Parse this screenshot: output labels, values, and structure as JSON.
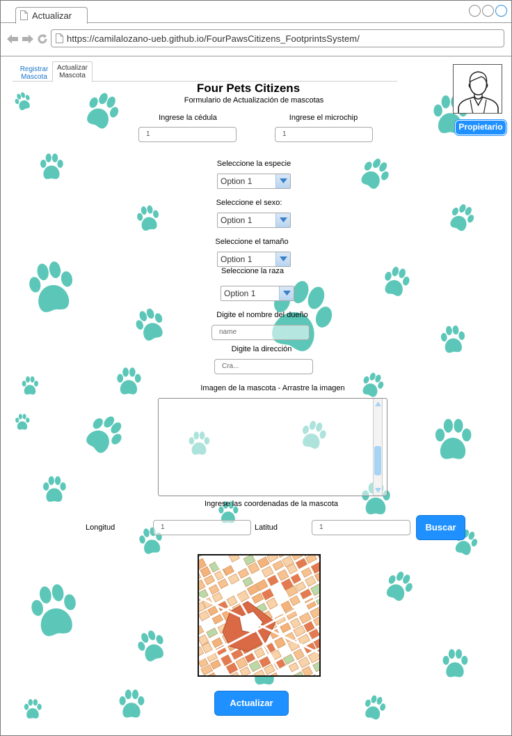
{
  "browser": {
    "tab_title": "Actualizar",
    "url": "https://camilalozano-ueb.github.io/FourPawsCitizens_FootprintsSystem/"
  },
  "tabs": {
    "register_label": "Registrar Mascota",
    "update_label": "Actualizar Mascota"
  },
  "header": {
    "title": "Four Pets Citizens",
    "subtitle": "Formulario de Actualización de mascotas"
  },
  "profile": {
    "owner_button": "Propietario",
    "avatar_icon": "user-avatar-icon"
  },
  "form": {
    "cedula_label": "Ingrese la cédula",
    "cedula_value": "1",
    "microchip_label": "Ingrese el microchip",
    "microchip_value": "1",
    "species_label": "Seleccione la especie",
    "species_value": "Option 1",
    "sex_label": "Seleccione el sexo:",
    "sex_value": "Option 1",
    "size_label": "Seleccione el tamaño",
    "size_value": "Option 1",
    "breed_label": "Seleccione la raza",
    "breed_value": "Option 1",
    "owner_name_label": "Digite el nombre del dueño",
    "owner_name_placeholder": "name",
    "address_label": "Digite la dirección",
    "address_placeholder": "Cra...",
    "image_label": "Imagen de la mascota - Arrastre la imagen",
    "coords_label": "Ingrese las coordenadas de la mascota",
    "longitude_label": "Longitud",
    "longitude_value": "1",
    "latitude_label": "Latitud",
    "latitude_value": "1",
    "search_button": "Buscar",
    "update_button": "Actualizar"
  },
  "colors": {
    "accent": "#1e90ff",
    "paw": "#5cc7b8",
    "link": "#1a73c8"
  }
}
